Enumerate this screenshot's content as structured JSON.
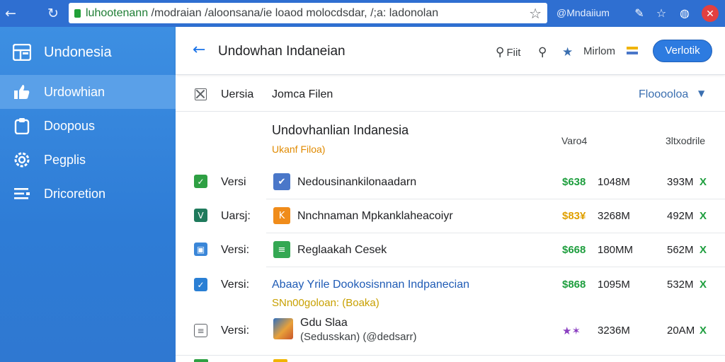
{
  "browser": {
    "back_icon": "back-arrow-icon",
    "reload_icon": "reload-icon",
    "url_host": "luhootenann",
    "url_path": " /modraian /aloonsana/ie loaod molocdsdar, /;a: ladonolan",
    "user_label": "@Mndaiium"
  },
  "sidebar": {
    "title": "Undonesia",
    "items": [
      {
        "label": "Urdowhian",
        "icon": "thumbs-up-icon",
        "active": true
      },
      {
        "label": "Doopous",
        "icon": "clipboard-icon",
        "active": false
      },
      {
        "label": "Pegplis",
        "icon": "gear-icon",
        "active": false
      },
      {
        "label": "Dricoretion",
        "icon": "list-icon",
        "active": false
      }
    ]
  },
  "header": {
    "title": "Undowhan Indaneian",
    "find_label": "Fiit",
    "mirror_label": "Mirlom",
    "action_button": "Verlotik"
  },
  "toolbar": {
    "col_version": "Uersia",
    "col_file": "Jomca Filen",
    "filter_label": "Flooooloa"
  },
  "table": {
    "group_title": "Undovhanlian Indanesia",
    "group_subtitle": "Ukanf Filoa)",
    "col_size": "Varo4",
    "col_size2": "3ltxodrile",
    "rows": [
      {
        "check_color": "#2ea043",
        "check_glyph": "✓",
        "version": "Versi",
        "file_icon_color": "#4a77c9",
        "file_glyph": "✔",
        "name": "Nedousinankilonaadarn",
        "price": "$638",
        "price_color": "#1e9e3e",
        "size1": "1048M",
        "size2": "393M",
        "x": "X"
      },
      {
        "check_color": "#1f7a5c",
        "check_glyph": "V",
        "version": "Uarsj:",
        "file_icon_color": "#f08c1a",
        "file_glyph": "K",
        "name": "Nnchnaman Mpkanklaheacoiyr",
        "price": "$83¥",
        "price_color": "#e0a000",
        "size1": "3268M",
        "size2": "492M",
        "x": "X"
      },
      {
        "check_color": "#3a86d8",
        "check_glyph": "▣",
        "version": "Versi:",
        "file_icon_color": "#34a853",
        "file_glyph": "≡",
        "name": "Reglaakah Cesek",
        "price": "$668",
        "price_color": "#1e9e3e",
        "size1": "180MM",
        "size2": "562M",
        "x": "X"
      },
      {
        "check_color": "#2a7fd4",
        "check_glyph": "✓",
        "version": "Versi:",
        "name": "Abaay Yrile Dookosisnnan Indpanecian",
        "name_link": true,
        "sub": "SNn00goloan: (Boaka)",
        "sub_color": "#c8a000",
        "price": "$868",
        "price_color": "#1e9e3e",
        "size1": "1095M",
        "size2": "532M",
        "x": "X"
      },
      {
        "version": "Versi:",
        "name": "Gdu Slaa",
        "sub": "(Sedusskan) (@dedsarr)",
        "sub_color": "#3c4043",
        "price": "★✶",
        "price_color": "#8a3fc0",
        "size1": "3236M",
        "size2": "20AM",
        "x": "X"
      }
    ]
  },
  "colors": {
    "chrome": "#2f6fd1",
    "sidebar": "#3d8fe2",
    "accent": "#2d7be0",
    "success": "#1e9e3e"
  }
}
